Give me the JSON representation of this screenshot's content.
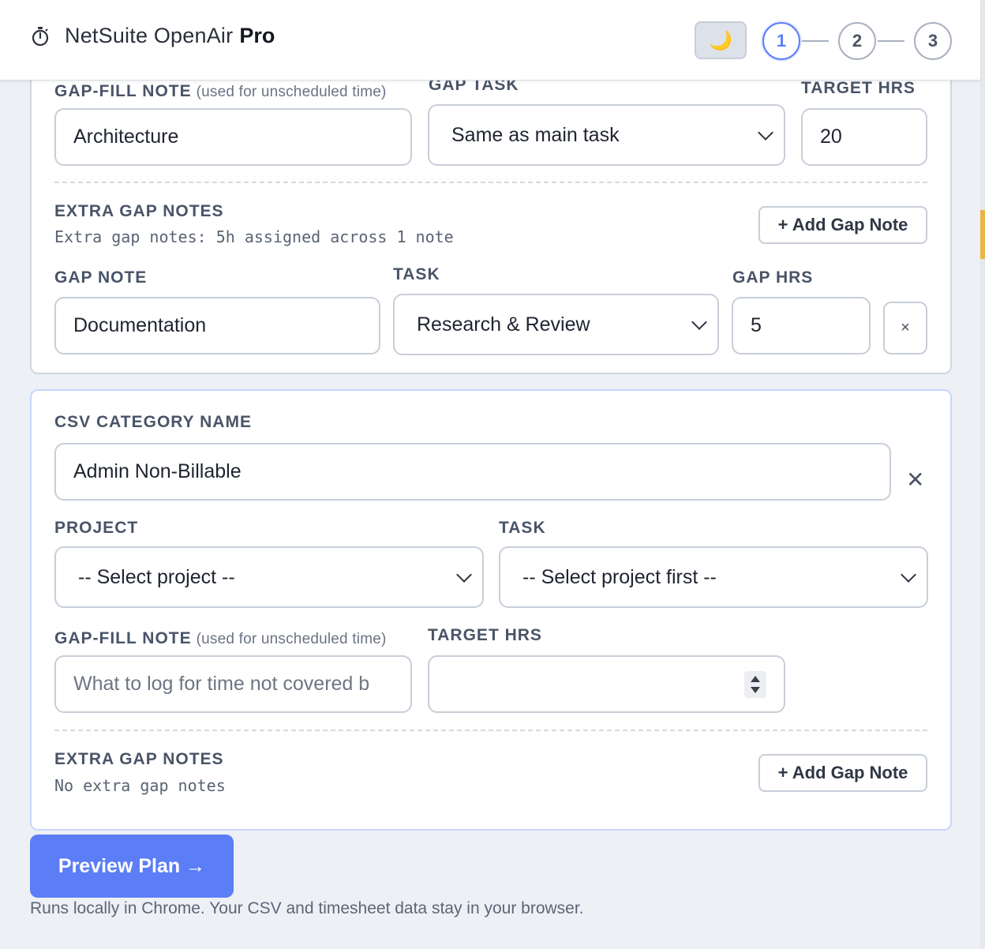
{
  "app": {
    "name": "NetSuite OpenAir",
    "edition": "Pro",
    "theme_toggle_glyph": "🌙",
    "steps": [
      "1",
      "2",
      "3"
    ],
    "active_step": "1"
  },
  "card1": {
    "gap_fill_label": "GAP-FILL NOTE",
    "gap_fill_hint": "(used for unscheduled time)",
    "gap_fill_value": "Architecture",
    "gap_task_label": "GAP TASK",
    "gap_task_value": "Same as main task",
    "target_label": "TARGET HRS",
    "target_value": "20",
    "extra_label": "EXTRA GAP NOTES",
    "extra_summary": "Extra gap notes: 5h assigned across 1 note",
    "add_button": "+ Add Gap Note",
    "row": {
      "note_label": "GAP NOTE",
      "note_value": "Documentation",
      "task_label": "TASK",
      "task_value": "Research & Review",
      "hrs_label": "GAP HRS",
      "hrs_value": "5",
      "remove": "×"
    }
  },
  "card2": {
    "csv_label": "CSV CATEGORY NAME",
    "csv_value": "Admin Non-Billable",
    "remove": "✕",
    "project_label": "PROJECT",
    "project_value": "-- Select project --",
    "task_label": "TASK",
    "task_value": "-- Select project first --",
    "gap_fill_label": "GAP-FILL NOTE",
    "gap_fill_hint": "(used for unscheduled time)",
    "gap_fill_placeholder": "What to log for time not covered b",
    "target_label": "TARGET HRS",
    "target_value": "",
    "extra_label": "EXTRA GAP NOTES",
    "extra_summary": "No extra gap notes",
    "add_button": "+ Add Gap Note"
  },
  "actions": {
    "preview_button": "Preview Plan →",
    "footer": "Runs locally in Chrome. Your CSV and timesheet data stay in your browser."
  },
  "colors": {
    "accent": "#5b7ef7",
    "page_bg": "#edf0f5"
  }
}
